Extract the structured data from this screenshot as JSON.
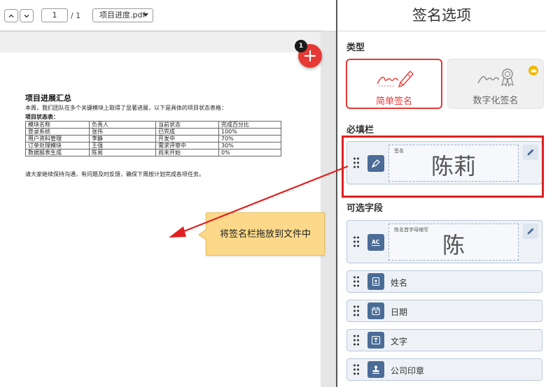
{
  "toolbar": {
    "page_current": "1",
    "page_total": "/ 1",
    "filename": "项目进度.pdf"
  },
  "badge": "1",
  "document": {
    "title": "项目进展汇总",
    "intro": "本周，我们团队在多个关键模块上取得了显著进展，以下是具体的项目状态表格：",
    "table_title": "项目状态表：",
    "headers": [
      "模块名称",
      "负责人",
      "当前状态",
      "完成百分比"
    ],
    "rows": [
      [
        "登录系统",
        "张伟",
        "已完成",
        "100%"
      ],
      [
        "用户资料管理",
        "李静",
        "开发中",
        "70%"
      ],
      [
        "订单处理模块",
        "王强",
        "需求评审中",
        "30%"
      ],
      [
        "数据报表生成",
        "陈易",
        "尚未开始",
        "0%"
      ]
    ],
    "footer": "请大家继续保持沟通，有问题及时反馈，确保下周按计划完成各项任务。"
  },
  "tooltip": "将签名栏拖放到文件中",
  "panel": {
    "title": "签名选项",
    "type_section": "类型",
    "types": [
      {
        "label": "简单签名",
        "icon": "pen-signature-icon",
        "selected": true
      },
      {
        "label": "数字化签名",
        "icon": "certificate-signature-icon",
        "premium": true
      }
    ],
    "required_section": "必填栏",
    "required_field": {
      "caption": "签名",
      "value": "陈莉",
      "icon": "pen-nib-icon"
    },
    "optional_section": "可选字段",
    "initials_field": {
      "caption": "姓名首字母缩写",
      "value": "陈",
      "icon": "text-ac-icon"
    },
    "optional_fields": [
      {
        "label": "姓名",
        "icon": "id-card-icon"
      },
      {
        "label": "日期",
        "icon": "calendar-icon"
      },
      {
        "label": "文字",
        "icon": "text-t-icon"
      },
      {
        "label": "公司印章",
        "icon": "stamp-icon"
      }
    ]
  },
  "colors": {
    "accent_red": "#e53935",
    "field_icon_bg": "#4a6c96",
    "tooltip_bg": "#fcd98a",
    "premium_gold": "#f3b700"
  }
}
